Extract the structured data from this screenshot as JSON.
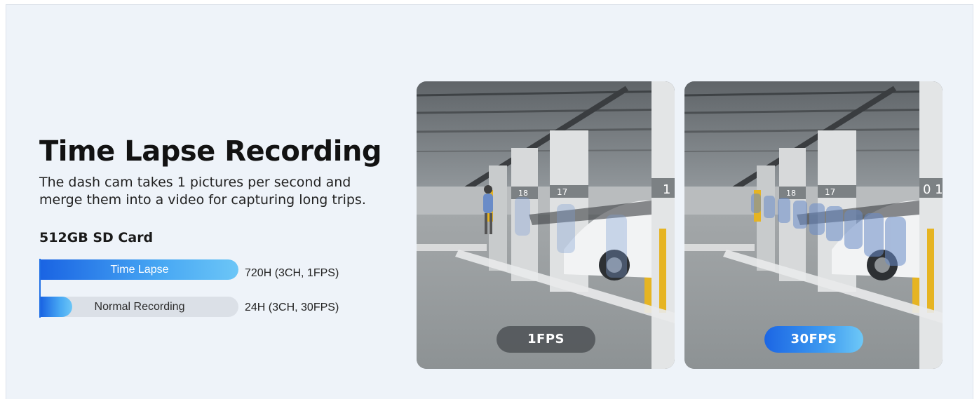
{
  "hero": {
    "title": "Time Lapse Recording",
    "description": "The dash cam takes 1 pictures per second and merge them into a video for capturing long trips."
  },
  "comparison": {
    "card_label": "512GB SD Card",
    "bars": [
      {
        "label": "Time Lapse",
        "value": "720H (3CH, 1FPS)",
        "fill_fraction": 1.0
      },
      {
        "label": "Normal Recording",
        "value": "24H (3CH, 30FPS)",
        "fill_fraction": 0.16
      }
    ]
  },
  "photos": [
    {
      "caption": "1FPS",
      "pillar_numbers": [
        "18",
        "17",
        "1"
      ]
    },
    {
      "caption": "30FPS",
      "pillar_numbers": [
        "18",
        "17",
        "0 1"
      ]
    }
  ],
  "colors": {
    "accent_blue": "#1a64e3",
    "light_blue": "#6cc6f7",
    "background": "#eef3f9",
    "pill_dark": "#505458"
  }
}
